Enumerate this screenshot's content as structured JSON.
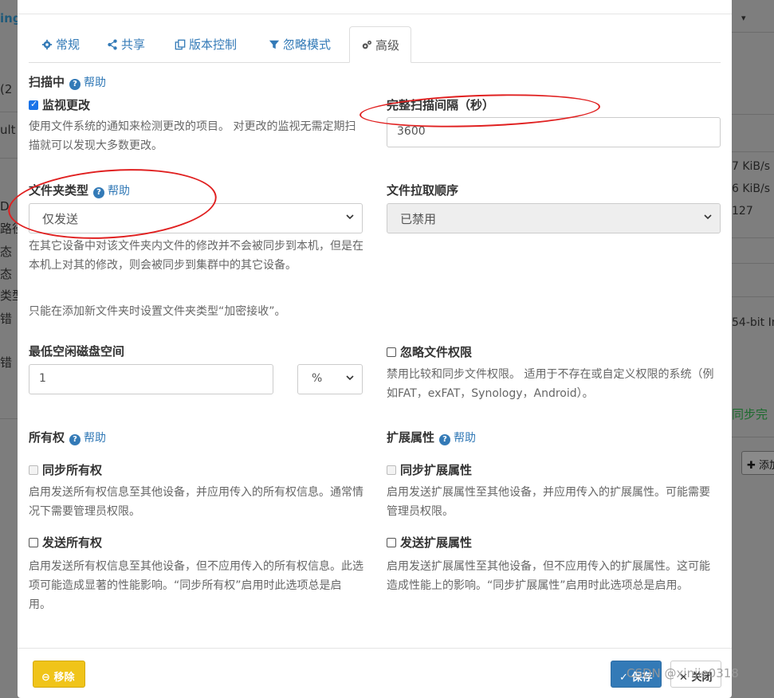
{
  "background": {
    "brand_fragment": "ing",
    "left_fragments": [
      "(2",
      "ult",
      "D",
      "路径",
      "态",
      "态",
      "类型",
      "错",
      "错"
    ],
    "right_fragments": [
      "7 KiB/s",
      "6 KiB/s",
      "127",
      "54-bit In",
      "同步完"
    ],
    "add_button": "✚ 添加"
  },
  "tabs": [
    {
      "label": "常规",
      "icon": "gear-icon"
    },
    {
      "label": "共享",
      "icon": "share-icon"
    },
    {
      "label": "版本控制",
      "icon": "copy-icon"
    },
    {
      "label": "忽略模式",
      "icon": "filter-icon"
    },
    {
      "label": "高级",
      "icon": "gears-icon",
      "active": true
    }
  ],
  "help_label": "帮助",
  "scanning": {
    "title": "扫描中",
    "watch_label": "监视更改",
    "watch_checked": true,
    "watch_desc": "使用文件系统的通知来检测更改的项目。 对更改的监视无需定期扫描就可以发现大多数更改。",
    "interval_label": "完整扫描间隔（秒）",
    "interval_value": "3600"
  },
  "folder_type": {
    "label": "文件夹类型",
    "value": "仅发送",
    "desc": "在其它设备中对该文件夹内文件的修改并不会被同步到本机，但是在本机上对其的修改，则会被同步到集群中的其它设备。",
    "note": "只能在添加新文件夹时设置文件夹类型“加密接收”。"
  },
  "pull_order": {
    "label": "文件拉取顺序",
    "value": "已禁用"
  },
  "min_disk": {
    "label": "最低空闲磁盘空间",
    "value": "1",
    "unit": "%"
  },
  "ignore_perms": {
    "label": "忽略文件权限",
    "checked": false,
    "desc": "禁用比较和同步文件权限。 适用于不存在或自定义权限的系统（例如FAT，exFAT，Synology，Android）。"
  },
  "ownership": {
    "title": "所有权",
    "sync_label": "同步所有权",
    "sync_desc": "启用发送所有权信息至其他设备，并应用传入的所有权信息。通常情况下需要管理员权限。",
    "send_label": "发送所有权",
    "send_desc": "启用发送所有权信息至其他设备，但不应用传入的所有权信息。此选项可能造成显著的性能影响。“同步所有权”启用时此选项总是启用。"
  },
  "xattrs": {
    "title": "扩展属性",
    "sync_label": "同步扩展属性",
    "sync_desc": "启用发送扩展属性至其他设备，并应用传入的扩展属性。可能需要管理员权限。",
    "send_label": "发送扩展属性",
    "send_desc": "启用发送扩展属性至其他设备，但不应用传入的扩展属性。这可能造成性能上的影响。“同步扩展属性”启用时此选项总是启用。"
  },
  "footer": {
    "remove": "移除",
    "save": "保存",
    "close": "关闭"
  },
  "watermark": "CSDN @xinjie0318",
  "colors": {
    "accent": "#337ab7",
    "warning": "#f0c419",
    "annotation": "#e02020"
  }
}
